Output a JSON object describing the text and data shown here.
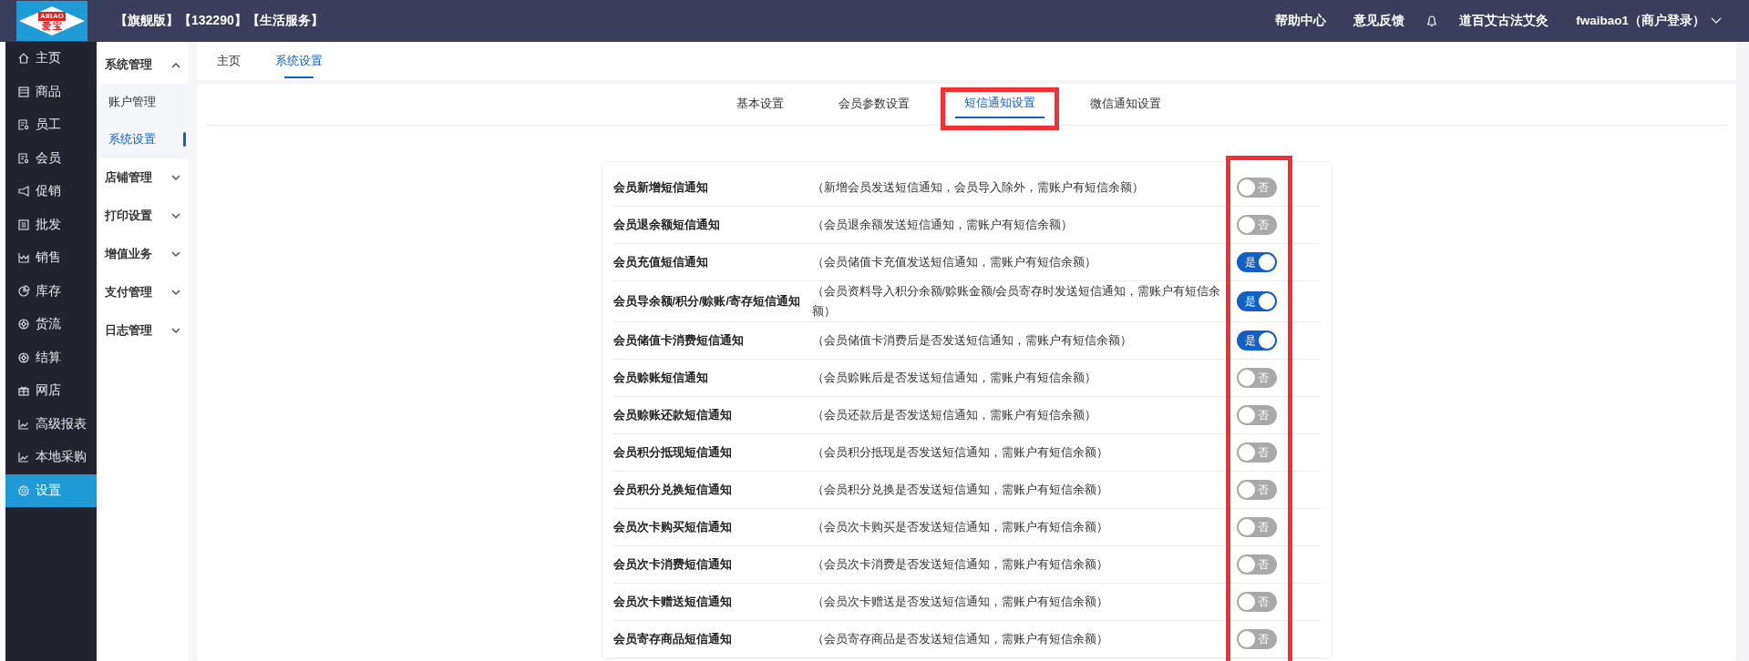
{
  "logo": {
    "top": "AIBAO",
    "bottom": "爱 宝"
  },
  "header": {
    "edition": "【旗舰版】【132290】【生活服务】",
    "links": [
      "帮助中心",
      "意见反馈"
    ],
    "store": "道百艾古法艾灸",
    "user": "fwaibao1（商户登录）"
  },
  "nav": [
    {
      "label": "主页",
      "selected": false
    },
    {
      "label": "商品",
      "selected": false
    },
    {
      "label": "员工",
      "selected": false
    },
    {
      "label": "会员",
      "selected": false
    },
    {
      "label": "促销",
      "selected": false
    },
    {
      "label": "批发",
      "selected": false
    },
    {
      "label": "销售",
      "selected": false
    },
    {
      "label": "库存",
      "selected": false
    },
    {
      "label": "货流",
      "selected": false
    },
    {
      "label": "结算",
      "selected": false
    },
    {
      "label": "网店",
      "selected": false
    },
    {
      "label": "高级报表",
      "selected": false
    },
    {
      "label": "本地采购",
      "selected": false
    },
    {
      "label": "设置",
      "selected": true
    }
  ],
  "sidebar": {
    "items": [
      {
        "label": "系统管理",
        "expanded": true,
        "children": [
          {
            "label": "账户管理",
            "selected": false
          },
          {
            "label": "系统设置",
            "selected": true
          }
        ]
      },
      {
        "label": "店铺管理",
        "expanded": false
      },
      {
        "label": "打印设置",
        "expanded": false
      },
      {
        "label": "增值业务",
        "expanded": false
      },
      {
        "label": "支付管理",
        "expanded": false
      },
      {
        "label": "日志管理",
        "expanded": false
      }
    ]
  },
  "tabs": [
    {
      "label": "主页",
      "selected": false
    },
    {
      "label": "系统设置",
      "selected": true
    }
  ],
  "subtabs": [
    {
      "label": "基本设置",
      "selected": false,
      "highlighted": false
    },
    {
      "label": "会员参数设置",
      "selected": false,
      "highlighted": false
    },
    {
      "label": "短信通知设置",
      "selected": true,
      "highlighted": true
    },
    {
      "label": "微信通知设置",
      "selected": false,
      "highlighted": false
    }
  ],
  "settings": {
    "toggles_highlighted": true,
    "rows": [
      {
        "name": "会员新增短信通知",
        "desc": "（新增会员发送短信通知，会员导入除外，需账户有短信余额）",
        "on": false,
        "state_text": "否"
      },
      {
        "name": "会员退余额短信通知",
        "desc": "（会员退余额发送短信通知，需账户有短信余额）",
        "on": false,
        "state_text": "否"
      },
      {
        "name": "会员充值短信通知",
        "desc": "（会员储值卡充值发送短信通知，需账户有短信余额）",
        "on": true,
        "state_text": "是"
      },
      {
        "name": "会员导余额/积分/赊账/寄存短信通知",
        "desc": "（会员资料导入积分余额/赊账金额/会员寄存时发送短信通知，需账户有短信余额）",
        "on": true,
        "state_text": "是"
      },
      {
        "name": "会员储值卡消费短信通知",
        "desc": "（会员储值卡消费后是否发送短信通知，需账户有短信余额）",
        "on": true,
        "state_text": "是"
      },
      {
        "name": "会员赊账短信通知",
        "desc": "（会员赊账后是否发送短信通知，需账户有短信余额）",
        "on": false,
        "state_text": "否"
      },
      {
        "name": "会员赊账还款短信通知",
        "desc": "（会员还款后是否发送短信通知，需账户有短信余额）",
        "on": false,
        "state_text": "否"
      },
      {
        "name": "会员积分抵现短信通知",
        "desc": "（会员积分抵现是否发送短信通知，需账户有短信余额）",
        "on": false,
        "state_text": "否"
      },
      {
        "name": "会员积分兑换短信通知",
        "desc": "（会员积分兑换是否发送短信通知，需账户有短信余额）",
        "on": false,
        "state_text": "否"
      },
      {
        "name": "会员次卡购买短信通知",
        "desc": "（会员次卡购买是否发送短信通知，需账户有短信余额）",
        "on": false,
        "state_text": "否"
      },
      {
        "name": "会员次卡消费短信通知",
        "desc": "（会员次卡消费是否发送短信通知，需账户有短信余额）",
        "on": false,
        "state_text": "否"
      },
      {
        "name": "会员次卡赠送短信通知",
        "desc": "（会员次卡赠送是否发送短信通知，需账户有短信余额）",
        "on": false,
        "state_text": "否"
      },
      {
        "name": "会员寄存商品短信通知",
        "desc": "（会员寄存商品是否发送短信通知，需账户有短信余额）",
        "on": false,
        "state_text": "否"
      }
    ]
  }
}
